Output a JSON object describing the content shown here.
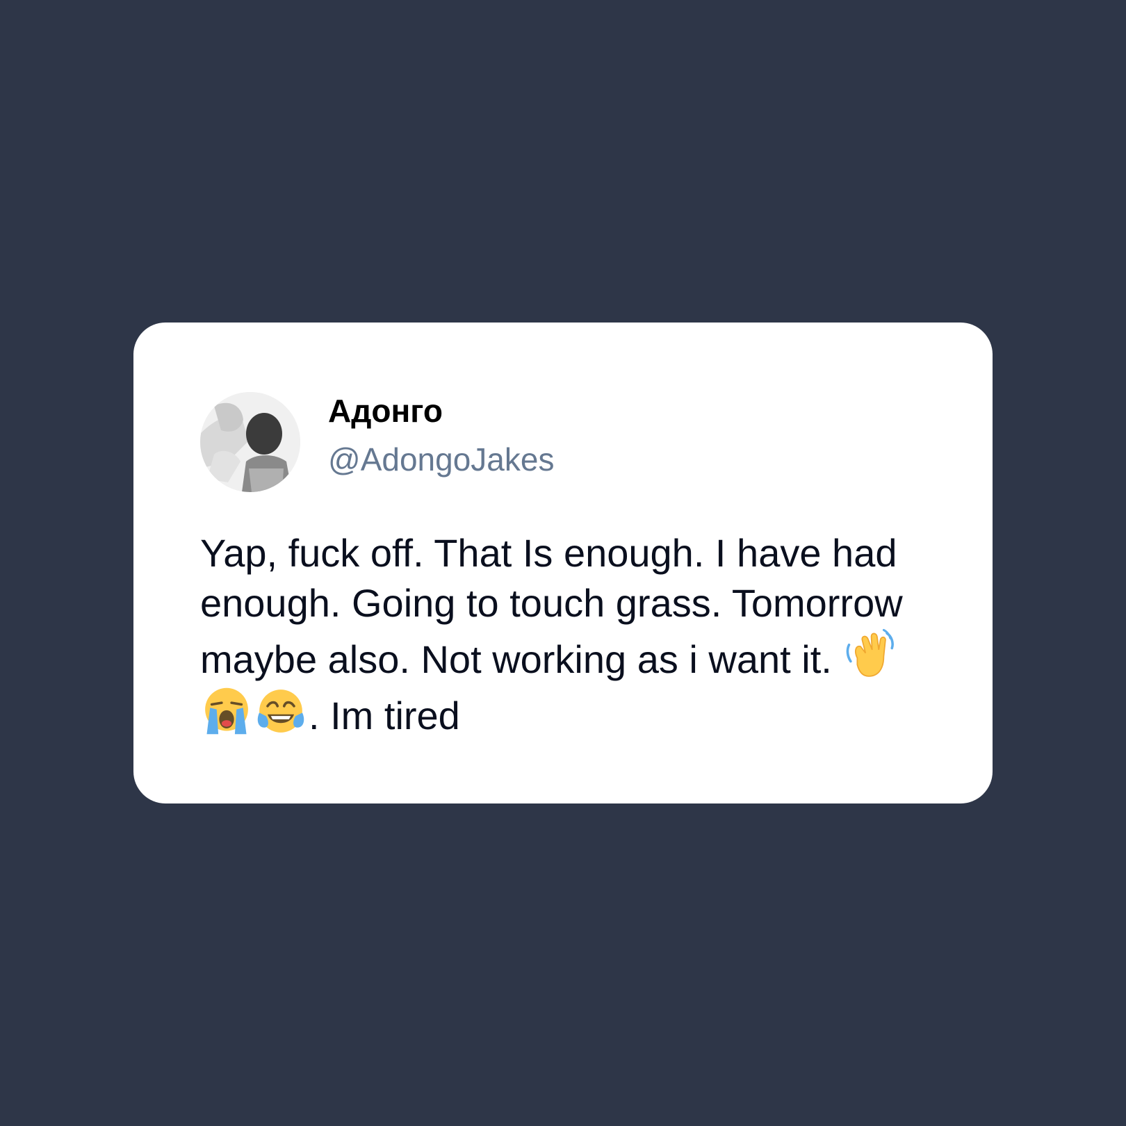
{
  "tweet": {
    "display_name": "Адонго",
    "handle": "@AdongoJakes",
    "text_before_emoji": "Yap, fuck off. That Is enough. I have had enough. Going to touch grass. Tomorrow maybe also. Not working as i want it. ",
    "emojis": [
      "waving-hand-emoji",
      "loudly-crying-face-emoji",
      "face-with-tears-of-joy-emoji"
    ],
    "text_after_emoji": ". Im tired"
  },
  "colors": {
    "background": "#2e3648",
    "card": "#ffffff",
    "handle": "#657891",
    "text": "#0a0f1e"
  }
}
